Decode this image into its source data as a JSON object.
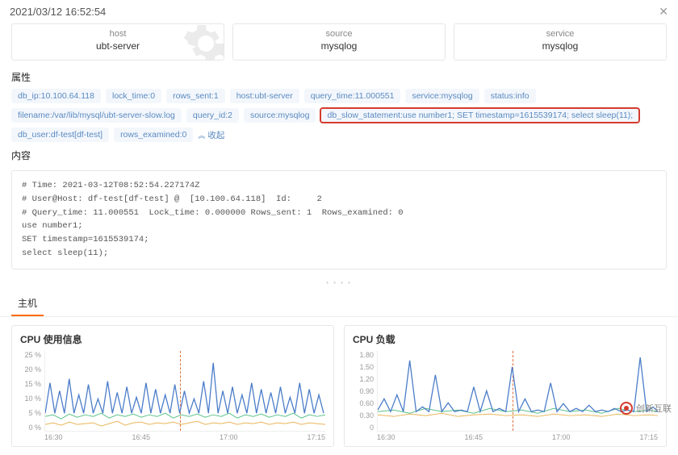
{
  "header": {
    "timestamp": "2021/03/12 16:52:54"
  },
  "summary_cards": [
    {
      "label": "host",
      "value": "ubt-server",
      "has_gear": true
    },
    {
      "label": "source",
      "value": "mysqlog",
      "has_gear": false
    },
    {
      "label": "service",
      "value": "mysqlog",
      "has_gear": false
    }
  ],
  "sections": {
    "attributes_title": "属性",
    "content_title": "内容",
    "host_tab": "主机"
  },
  "tags": [
    "db_ip:10.100.64.118",
    "lock_time:0",
    "rows_sent:1",
    "host:ubt-server",
    "query_time:11.000551",
    "service:mysqlog",
    "status:info",
    "filename:/var/lib/mysql/ubt-server-slow.log",
    "query_id:2",
    "source:mysqlog",
    "db_slow_statement:use number1; SET timestamp=1615539174; select sleep(11);",
    "db_user:df-test[df-test]",
    "rows_examined:0"
  ],
  "highlighted_tag_index": 10,
  "collapse_label": "收起",
  "content_text": "# Time: 2021-03-12T08:52:54.227174Z\n# User@Host: df-test[df-test] @  [10.100.64.118]  Id:     2\n# Query_time: 11.000551  Lock_time: 0.000000 Rows_sent: 1  Rows_examined: 0\nuse number1;\nSET timestamp=1615539174;\nselect sleep(11);",
  "charts": {
    "cpu_usage": {
      "title": "CPU 使用信息",
      "y_ticks": [
        "25 %",
        "20 %",
        "15 %",
        "10 %",
        "5 %",
        "0 %"
      ],
      "x_ticks": [
        "16:30",
        "16:45",
        "17:00",
        "17:15"
      ]
    },
    "cpu_load": {
      "title": "CPU 负载",
      "y_ticks": [
        "1.80",
        "1.50",
        "1.20",
        "0.90",
        "0.60",
        "0.30",
        "0"
      ],
      "x_ticks": [
        "16:30",
        "16:45",
        "17:00",
        "17:15"
      ]
    }
  },
  "watermark": "创新互联",
  "chart_data": [
    {
      "type": "line",
      "title": "CPU 使用信息",
      "ylabel": "%",
      "ylim": [
        0,
        25
      ],
      "x_ticks": [
        "16:30",
        "16:45",
        "17:00",
        "17:15"
      ],
      "marker_time": "16:52:54",
      "series": [
        {
          "name": "blue",
          "color": "#4a7cc9",
          "approx_range": [
            5,
            22
          ],
          "baseline": 5,
          "note": "spiky, many peaks between 10-22%"
        },
        {
          "name": "green",
          "color": "#5cc28a",
          "approx_range": [
            3,
            6
          ],
          "baseline": 4
        },
        {
          "name": "orange",
          "color": "#e8b659",
          "approx_range": [
            1,
            4
          ],
          "baseline": 2
        }
      ]
    },
    {
      "type": "line",
      "title": "CPU 负载",
      "ylabel": "",
      "ylim": [
        0,
        1.8
      ],
      "x_ticks": [
        "16:30",
        "16:45",
        "17:00",
        "17:15"
      ],
      "marker_time": "16:52:54",
      "series": [
        {
          "name": "blue",
          "color": "#4a7cc9",
          "approx_range": [
            0.3,
            1.8
          ],
          "baseline": 0.4,
          "note": "occasional spikes to ~1.5-1.8"
        },
        {
          "name": "green",
          "color": "#5cc28a",
          "approx_range": [
            0.3,
            0.6
          ],
          "baseline": 0.4
        },
        {
          "name": "orange",
          "color": "#e8b659",
          "approx_range": [
            0.25,
            0.5
          ],
          "baseline": 0.35
        }
      ]
    }
  ]
}
